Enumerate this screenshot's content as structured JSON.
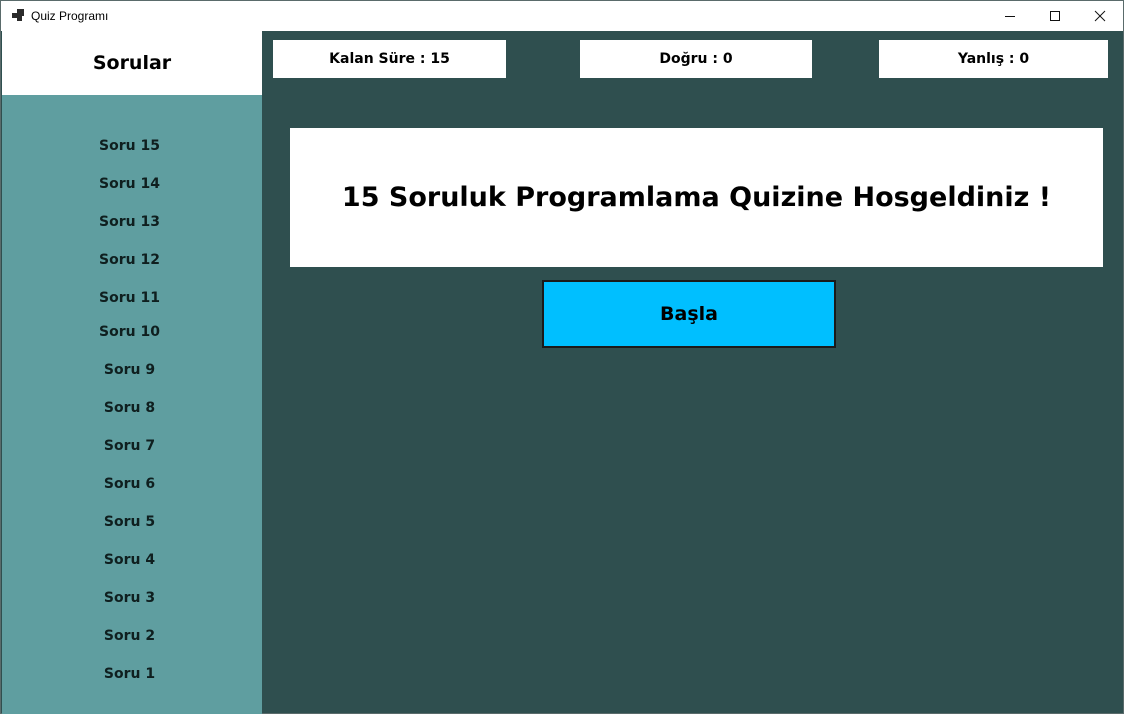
{
  "window": {
    "title": "Quiz Programı",
    "controls": {
      "minimize": "minimize-icon",
      "maximize": "maximize-icon",
      "close": "close-icon"
    }
  },
  "sidebar": {
    "title": "Sorular",
    "items": [
      {
        "label": "Soru 15"
      },
      {
        "label": "Soru 14"
      },
      {
        "label": "Soru 13"
      },
      {
        "label": "Soru 12"
      },
      {
        "label": "Soru 11"
      },
      {
        "label": "Soru 10"
      },
      {
        "label": "Soru 9"
      },
      {
        "label": "Soru 8"
      },
      {
        "label": "Soru 7"
      },
      {
        "label": "Soru 6"
      },
      {
        "label": "Soru 5"
      },
      {
        "label": "Soru 4"
      },
      {
        "label": "Soru 3"
      },
      {
        "label": "Soru 2"
      },
      {
        "label": "Soru 1"
      }
    ]
  },
  "stats": {
    "time_left": "Kalan Süre : 15",
    "correct": "Doğru : 0",
    "wrong": "Yanlış : 0"
  },
  "main": {
    "welcome_text": "15 Soruluk Programlama Quizine Hosgeldiniz !",
    "start_label": "Başla"
  },
  "colors": {
    "background": "#2f4f4f",
    "sidebar": "#5f9ea0",
    "start_button": "#00bfff"
  }
}
